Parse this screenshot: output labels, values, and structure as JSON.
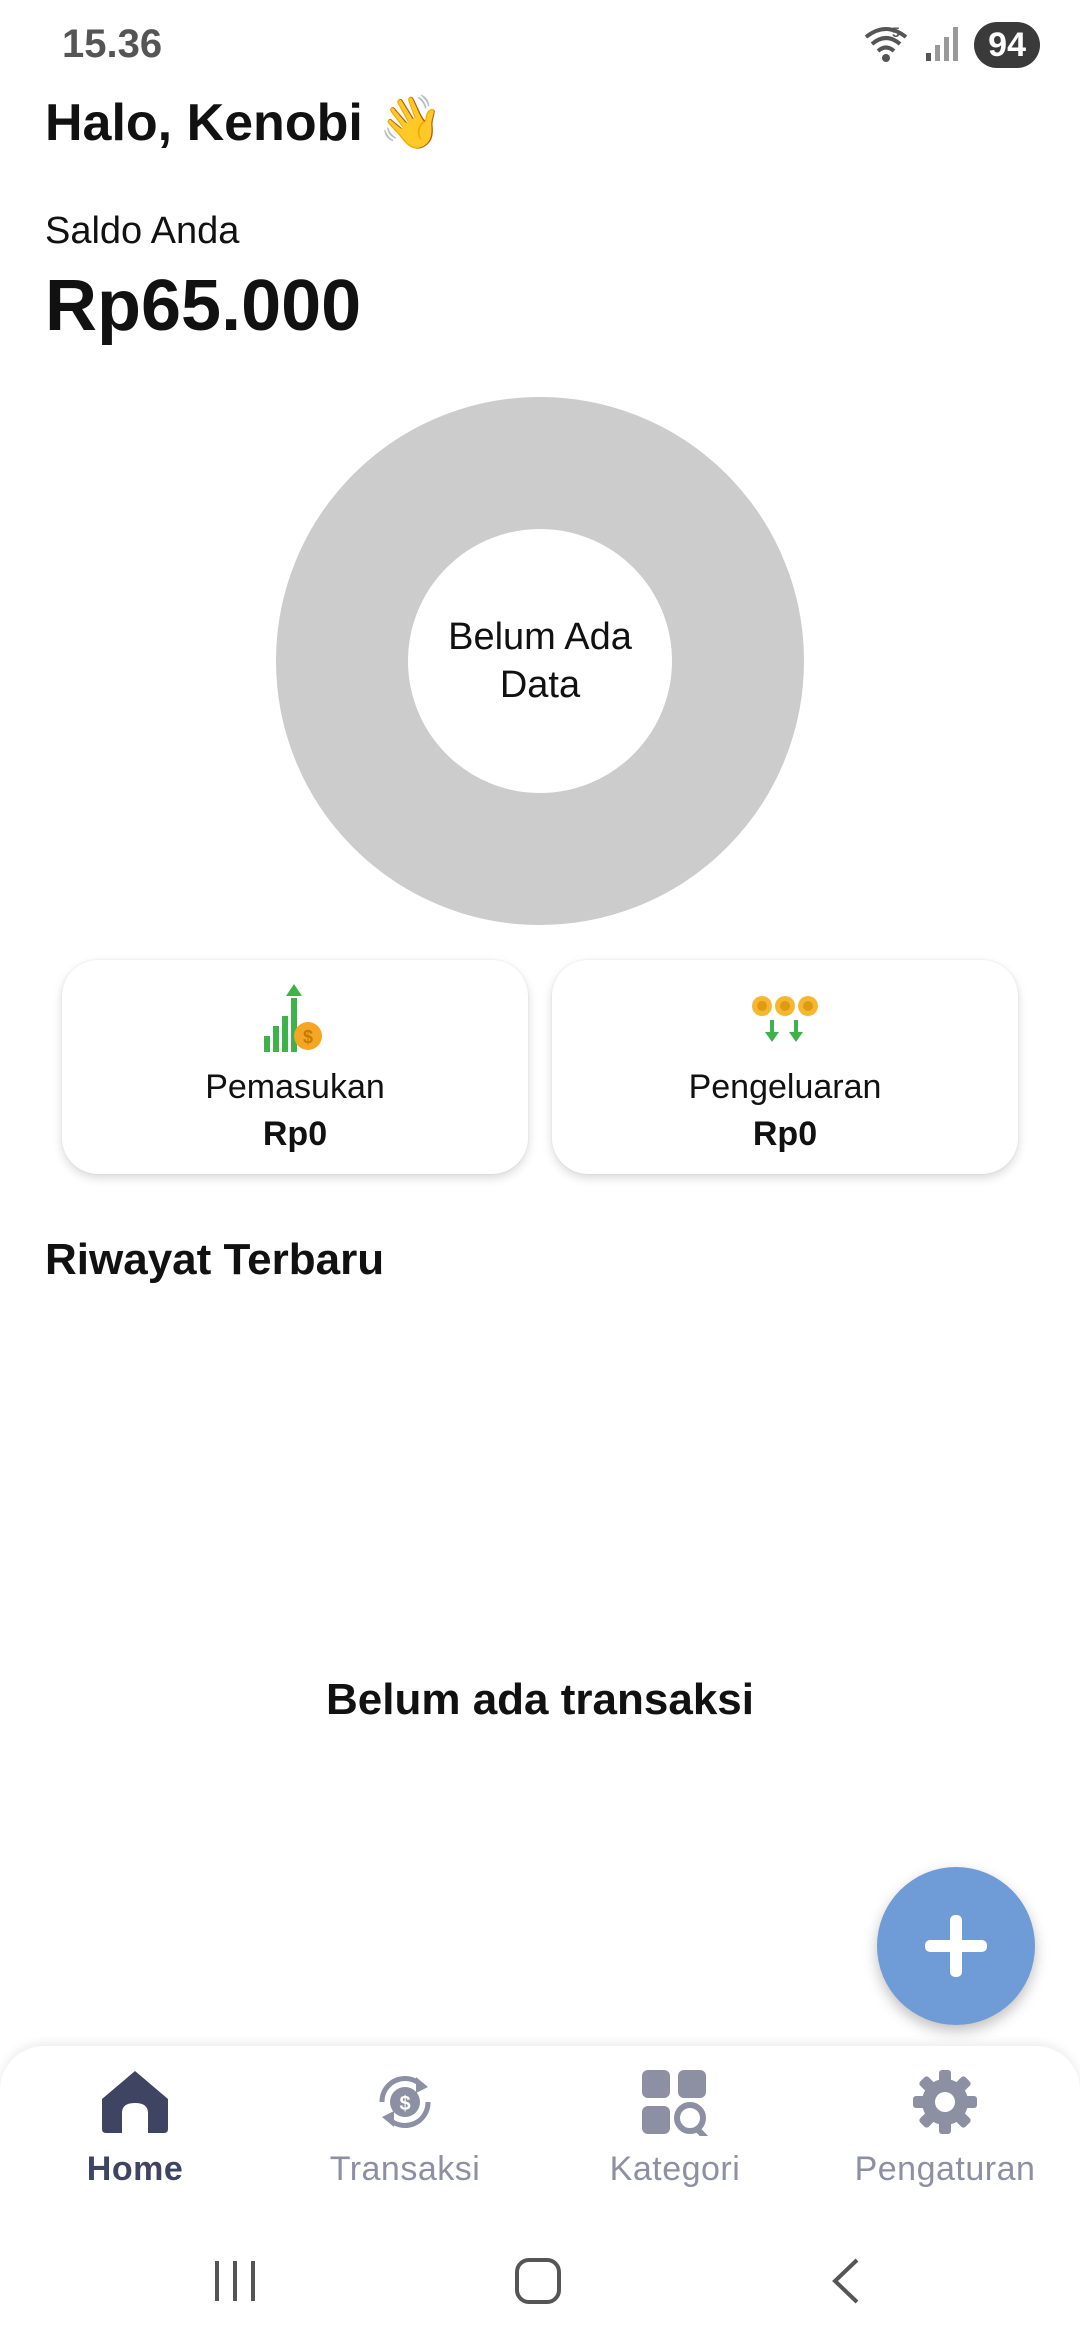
{
  "status_bar": {
    "time": "15.36",
    "battery": "94"
  },
  "header": {
    "greeting": "Halo, Kenobi",
    "greeting_emoji": "👋"
  },
  "balance": {
    "label": "Saldo Anda",
    "value": "Rp65.000"
  },
  "chart": {
    "empty_text": "Belum Ada\nData",
    "ring_color": "#cccccc"
  },
  "cards": {
    "income": {
      "label": "Pemasukan",
      "amount": "Rp0",
      "icon": "chart-coin-icon"
    },
    "expense": {
      "label": "Pengeluaran",
      "amount": "Rp0",
      "icon": "coins-down-icon"
    }
  },
  "history": {
    "title": "Riwayat Terbaru",
    "empty_text": "Belum ada transaksi"
  },
  "fab": {
    "icon": "plus-icon",
    "color": "#6f9bd6"
  },
  "bottom_nav": {
    "items": [
      {
        "label": "Home",
        "icon": "home-icon",
        "active": true
      },
      {
        "label": "Transaksi",
        "icon": "transaction-icon",
        "active": false
      },
      {
        "label": "Kategori",
        "icon": "category-search-icon",
        "active": false
      },
      {
        "label": "Pengaturan",
        "icon": "gear-icon",
        "active": false
      }
    ]
  },
  "colors": {
    "nav_active": "#3e4461",
    "nav_inactive": "#8d8fa3"
  }
}
